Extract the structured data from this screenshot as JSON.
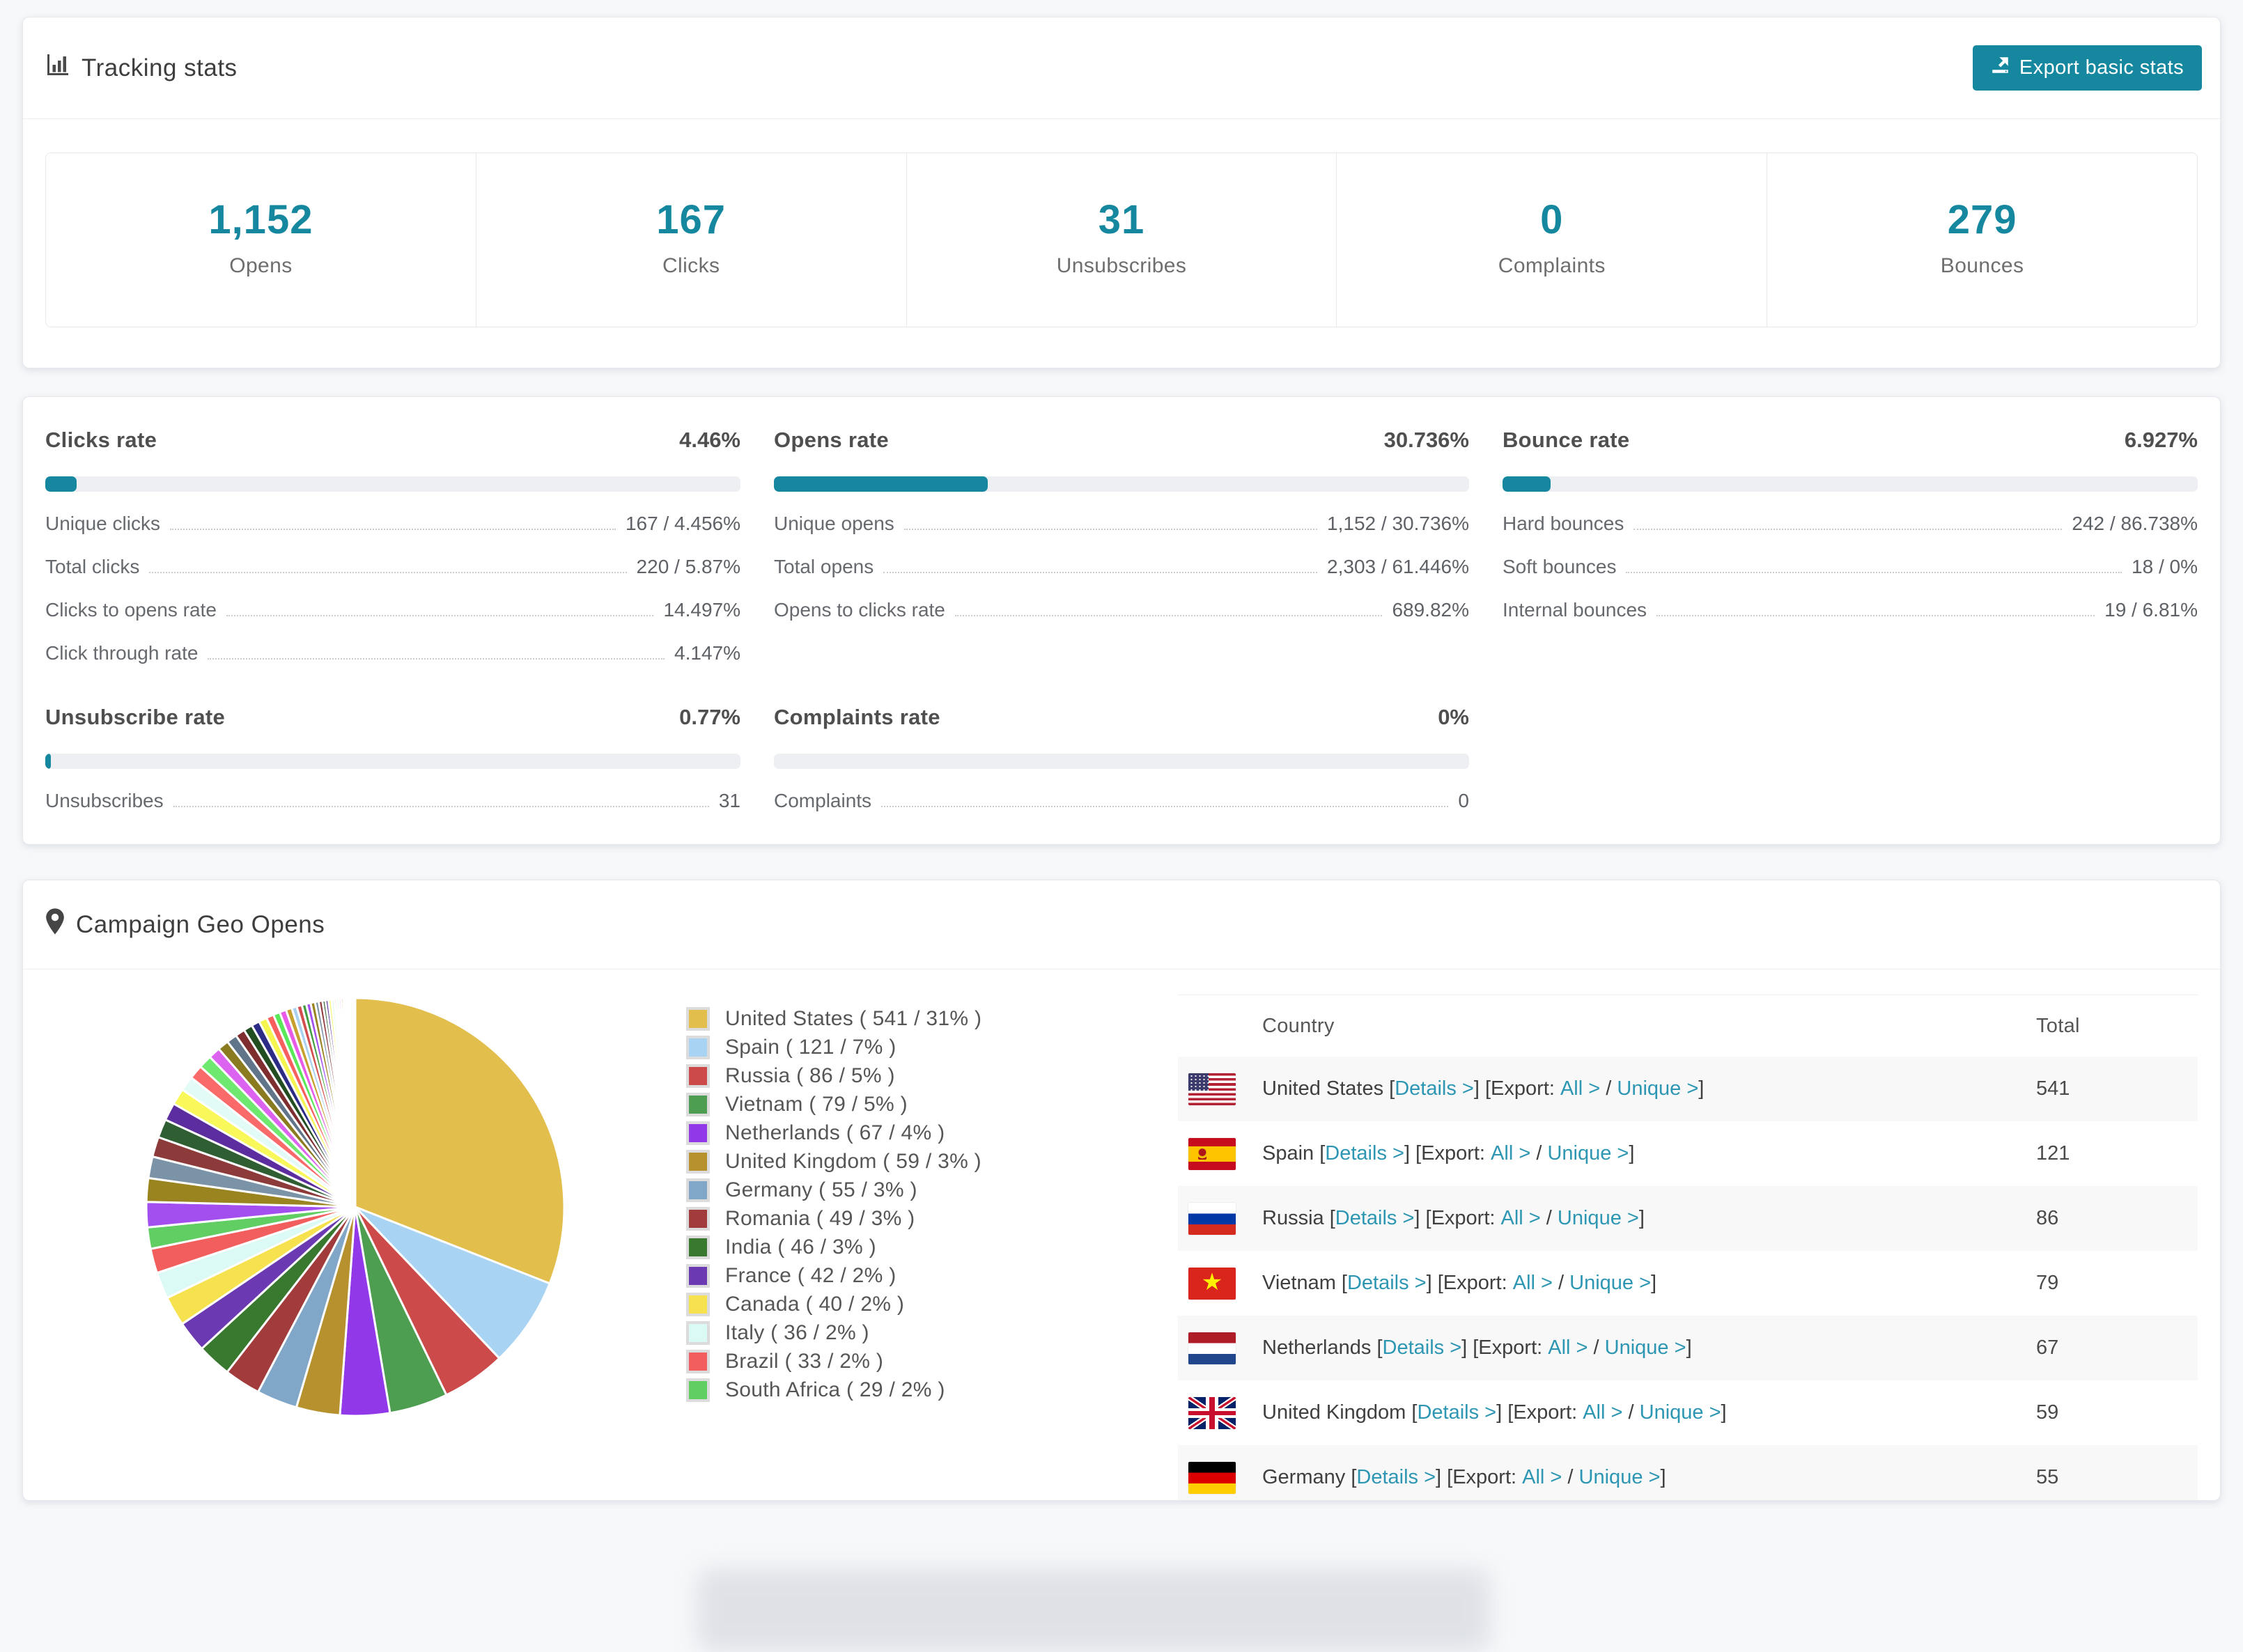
{
  "colors": {
    "accent": "#15889F",
    "link": "#2D96B2",
    "bar_track": "#EDEFF2",
    "row_stripe": "#F8F8F9"
  },
  "tracking": {
    "title": "Tracking stats",
    "export_button": "Export basic stats",
    "stats": [
      {
        "value": "1,152",
        "label": "Opens"
      },
      {
        "value": "167",
        "label": "Clicks"
      },
      {
        "value": "31",
        "label": "Unsubscribes"
      },
      {
        "value": "0",
        "label": "Complaints"
      },
      {
        "value": "279",
        "label": "Bounces"
      }
    ]
  },
  "rates": {
    "blocks": [
      {
        "title": "Clicks rate",
        "value": "4.46%",
        "percent": 4.46,
        "rows": [
          {
            "label": "Unique clicks",
            "value": "167 / 4.456%"
          },
          {
            "label": "Total clicks",
            "value": "220 / 5.87%"
          },
          {
            "label": "Clicks to opens rate",
            "value": "14.497%"
          },
          {
            "label": "Click through rate",
            "value": "4.147%"
          }
        ]
      },
      {
        "title": "Opens rate",
        "value": "30.736%",
        "percent": 30.736,
        "rows": [
          {
            "label": "Unique opens",
            "value": "1,152 / 30.736%"
          },
          {
            "label": "Total opens",
            "value": "2,303 / 61.446%"
          },
          {
            "label": "Opens to clicks rate",
            "value": "689.82%"
          }
        ]
      },
      {
        "title": "Bounce rate",
        "value": "6.927%",
        "percent": 6.927,
        "rows": [
          {
            "label": "Hard bounces",
            "value": "242 / 86.738%"
          },
          {
            "label": "Soft bounces",
            "value": "18 / 0%"
          },
          {
            "label": "Internal bounces",
            "value": "19 / 6.81%"
          }
        ]
      },
      {
        "title": "Unsubscribe rate",
        "value": "0.77%",
        "percent": 0.77,
        "rows": [
          {
            "label": "Unsubscribes",
            "value": "31"
          }
        ]
      },
      {
        "title": "Complaints rate",
        "value": "0%",
        "percent": 0,
        "rows": [
          {
            "label": "Complaints",
            "value": "0"
          }
        ]
      }
    ]
  },
  "geo": {
    "title": "Campaign Geo Opens",
    "legend": [
      {
        "label": "United States ( 541 / 31% )",
        "color": "#E2BF4C"
      },
      {
        "label": "Spain ( 121 / 7% )",
        "color": "#A9D3F2"
      },
      {
        "label": "Russia ( 86 / 5% )",
        "color": "#CC4A4A"
      },
      {
        "label": "Vietnam ( 79 / 5% )",
        "color": "#4D9E50"
      },
      {
        "label": "Netherlands ( 67 / 4% )",
        "color": "#9138E8"
      },
      {
        "label": "United Kingdom ( 59 / 3% )",
        "color": "#B6912E"
      },
      {
        "label": "Germany ( 55 / 3% )",
        "color": "#80A6C8"
      },
      {
        "label": "Romania ( 49 / 3% )",
        "color": "#A23C3C"
      },
      {
        "label": "India ( 46 / 3% )",
        "color": "#38792F"
      },
      {
        "label": "France ( 42 / 2% )",
        "color": "#6B3AB2"
      },
      {
        "label": "Canada ( 40 / 2% )",
        "color": "#F6E14E"
      },
      {
        "label": "Italy ( 36 / 2% )",
        "color": "#DCFAF5"
      },
      {
        "label": "Brazil ( 33 / 2% )",
        "color": "#F25E5E"
      },
      {
        "label": "South Africa ( 29 / 2% )",
        "color": "#60CE62"
      }
    ],
    "table": {
      "col_country": "Country",
      "col_total": "Total",
      "bracket_open": "[",
      "bracket_close": "]",
      "details_label": "Details >",
      "export_prefix": "[Export:",
      "all_label": "All >",
      "slash": "/",
      "unique_label": "Unique >",
      "rows": [
        {
          "country": "United States",
          "flag": "us",
          "total": "541"
        },
        {
          "country": "Spain",
          "flag": "es",
          "total": "121"
        },
        {
          "country": "Russia",
          "flag": "ru",
          "total": "86"
        },
        {
          "country": "Vietnam",
          "flag": "vn",
          "total": "79"
        },
        {
          "country": "Netherlands",
          "flag": "nl",
          "total": "67"
        },
        {
          "country": "United Kingdom",
          "flag": "gb",
          "total": "59"
        },
        {
          "country": "Germany",
          "flag": "de",
          "total": "55"
        }
      ]
    }
  },
  "chart_data": {
    "type": "pie",
    "title": "Campaign Geo Opens",
    "legend_position": "right",
    "labels": [
      "United States",
      "Spain",
      "Russia",
      "Vietnam",
      "Netherlands",
      "United Kingdom",
      "Germany",
      "Romania",
      "India",
      "France",
      "Canada",
      "Italy",
      "Brazil",
      "South Africa"
    ],
    "values": [
      541,
      121,
      86,
      79,
      67,
      59,
      55,
      49,
      46,
      42,
      40,
      36,
      33,
      29
    ],
    "percent_labels": [
      "31%",
      "7%",
      "5%",
      "5%",
      "4%",
      "3%",
      "3%",
      "3%",
      "3%",
      "2%",
      "2%",
      "2%",
      "2%",
      "2%"
    ],
    "colors": [
      "#E2BF4C",
      "#A9D3F2",
      "#CC4A4A",
      "#4D9E50",
      "#9138E8",
      "#B6912E",
      "#80A6C8",
      "#A23C3C",
      "#38792F",
      "#6B3AB2",
      "#F6E14E",
      "#DCFAF5",
      "#F25E5E",
      "#60CE62"
    ],
    "others_estimated_values": [
      34,
      32,
      29,
      27,
      25,
      24,
      22,
      20,
      19,
      18,
      16,
      15,
      14,
      13,
      12,
      11,
      11,
      10,
      9,
      9,
      8,
      7,
      7,
      6,
      6,
      6,
      5,
      5,
      4,
      4,
      4,
      4,
      3,
      3,
      3,
      3,
      2,
      2,
      2,
      2,
      2,
      2,
      2,
      1,
      1
    ],
    "others_palette": [
      "#A34FF0",
      "#9A8420",
      "#7B93A6",
      "#8C3A3A",
      "#2F5E33",
      "#5B2D9E",
      "#F8F85A",
      "#E2FBF7",
      "#FA6A6A",
      "#6EE86E",
      "#DB63F0",
      "#8A7A20",
      "#60748A",
      "#7E2E2E",
      "#224E22",
      "#2C2C86",
      "#F5F54F",
      "#FA5F5F",
      "#58E858",
      "#E85AE8",
      "#C8A030",
      "#A8D2F0",
      "#D34F4F",
      "#3F9E3F"
    ],
    "start_angle_deg": 0,
    "direction": "clockwise"
  }
}
